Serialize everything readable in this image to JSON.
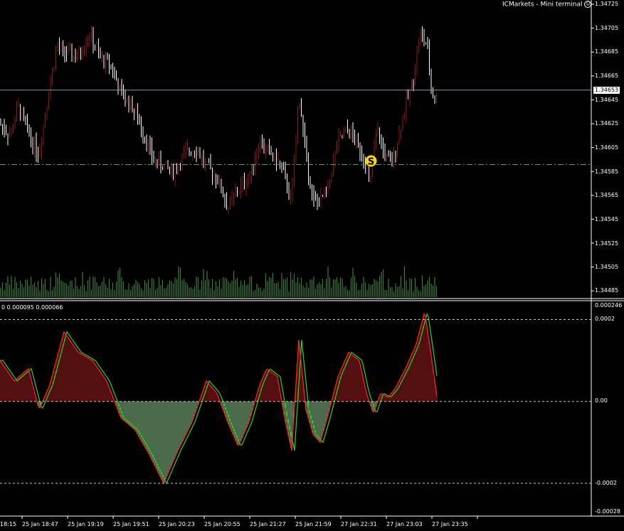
{
  "window": {
    "title": "ICMarkets - Mini terminal",
    "icon": "smiley-icon"
  },
  "colors": {
    "background": "#000000",
    "axis": "#ffffff",
    "bull": "#8b1a1a",
    "bear": "#ffffff",
    "volume": "#3f7a3f",
    "bid_line": "#8a9bb8",
    "level_line": "#5aa05a",
    "hist_pos": "#8b1a1a",
    "hist_neg": "#7fb07f",
    "signal_red": "#ff2020",
    "signal_green": "#20d020",
    "marker": "#ffd700"
  },
  "price_axis": {
    "ticks": [
      "1.34725",
      "1.34705",
      "1.34685",
      "1.34665",
      "1.34645",
      "1.34625",
      "1.34605",
      "1.34585",
      "1.34565",
      "1.34545",
      "1.34525",
      "1.34505",
      "1.34485"
    ],
    "current_price": "1.34653",
    "level_price": 1.34591,
    "ylim": [
      1.3448,
      1.34728
    ]
  },
  "indicator_panel": {
    "legend": "0 0.000095 0.000066",
    "axis_ticks": [
      "0.000246",
      "0.0002",
      "0.00",
      "-0.0002",
      "-0.00028"
    ],
    "ylim": [
      -0.00028,
      0.000246
    ],
    "dashed_levels": [
      0.0002,
      0,
      -0.0002
    ]
  },
  "time_axis": {
    "labels": [
      "18:15",
      "25 Jan 18:47",
      "25 Jan 19:19",
      "25 Jan 19:51",
      "25 Jan 20:23",
      "25 Jan 20:55",
      "25 Jan 21:27",
      "25 Jan 21:59",
      "27 Jan 22:31",
      "27 Jan 23:03",
      "27 Jan 23:35"
    ]
  },
  "marker": {
    "label": "S",
    "price": 1.34594,
    "bar_fraction": 0.848
  },
  "chart_data": {
    "type": "line",
    "title": "",
    "series": [
      {
        "x": [
          0,
          15,
          25,
          45,
          55,
          65,
          80,
          88,
          110,
          125,
          140,
          155,
          170,
          185,
          200,
          215,
          230,
          245,
          260,
          275,
          290,
          305,
          320,
          335,
          350,
          365,
          380,
          395,
          410,
          420,
          430,
          440,
          450,
          460,
          475,
          490,
          500,
          510,
          520,
          530,
          540,
          550,
          560,
          570,
          580,
          590,
          600,
          607,
          612
        ],
        "values": [
          1.34625,
          1.34615,
          1.3464,
          1.3461,
          1.346,
          1.3464,
          1.3469,
          1.34685,
          1.3468,
          1.347,
          1.3468,
          1.34675,
          1.3465,
          1.3464,
          1.3462,
          1.34595,
          1.3459,
          1.34585,
          1.346,
          1.34605,
          1.3459,
          1.3458,
          1.34555,
          1.3457,
          1.3458,
          1.3461,
          1.346,
          1.3459,
          1.3456,
          1.3465,
          1.346,
          1.3456,
          1.3456,
          1.3457,
          1.3461,
          1.3462,
          1.3461,
          1.346,
          1.34575,
          1.3462,
          1.346,
          1.3459,
          1.34615,
          1.3464,
          1.3466,
          1.347,
          1.3469,
          1.3465,
          1.34645
        ]
      }
    ],
    "osc_series": [
      {
        "x": [
          0,
          20,
          40,
          55,
          70,
          90,
          110,
          130,
          150,
          170,
          190,
          210,
          230,
          250,
          270,
          290,
          305,
          320,
          335,
          350,
          365,
          375,
          390,
          400,
          410,
          420,
          430,
          440,
          450,
          460,
          475,
          490,
          505,
          515,
          525,
          535,
          545,
          555,
          570,
          585,
          597,
          607,
          615
        ],
        "values": [
          0.0001,
          5e-05,
          8e-05,
          -2e-05,
          4e-05,
          0.00017,
          0.00012,
          0.0001,
          5e-05,
          -4e-05,
          -7e-05,
          -0.00013,
          -0.0002,
          -0.00012,
          -5e-05,
          5e-05,
          2e-05,
          -5e-05,
          -0.00011,
          -5e-05,
          4e-05,
          8e-05,
          6e-05,
          -4e-05,
          -0.00012,
          0.00015,
          -2e-05,
          -8e-05,
          -0.0001,
          -4e-05,
          6e-05,
          0.00012,
          0.0001,
          2e-05,
          -3e-05,
          2e-05,
          1e-05,
          3e-05,
          8e-05,
          0.00014,
          0.00022,
          0.0001,
          0.0
        ]
      }
    ]
  }
}
